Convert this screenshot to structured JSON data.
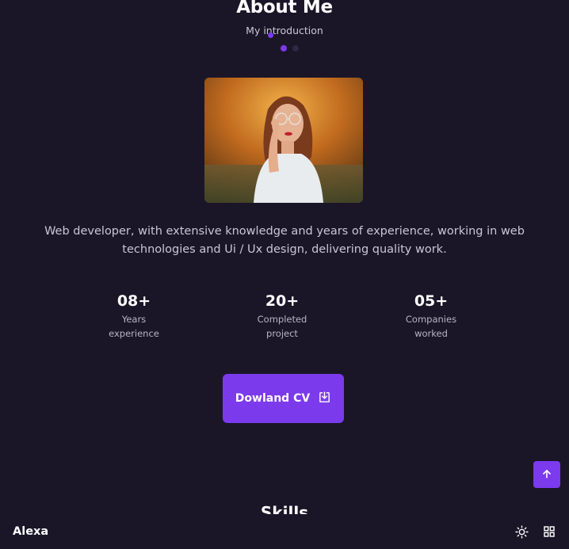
{
  "about": {
    "title": "About Me",
    "subtitle": "My introduction",
    "description": "Web developer, with extensive knowledge and years of experience, working in web technologies and Ui / Ux design, delivering quality work."
  },
  "stats": [
    {
      "value": "08+",
      "label_line1": "Years",
      "label_line2": "experience"
    },
    {
      "value": "20+",
      "label_line1": "Completed",
      "label_line2": "project"
    },
    {
      "value": "05+",
      "label_line1": "Companies",
      "label_line2": "worked"
    }
  ],
  "cv_button": {
    "label": "Dowland CV",
    "icon": "download-icon"
  },
  "skills": {
    "title": "Skills"
  },
  "nav": {
    "brand": "Alexa",
    "theme_icon": "sun-icon",
    "menu_icon": "grid-icon"
  },
  "scroll_top": {
    "icon": "arrow-up-icon"
  },
  "colors": {
    "background": "#1a1628",
    "accent": "#7c3aed",
    "text_muted": "#c9c6d4"
  }
}
